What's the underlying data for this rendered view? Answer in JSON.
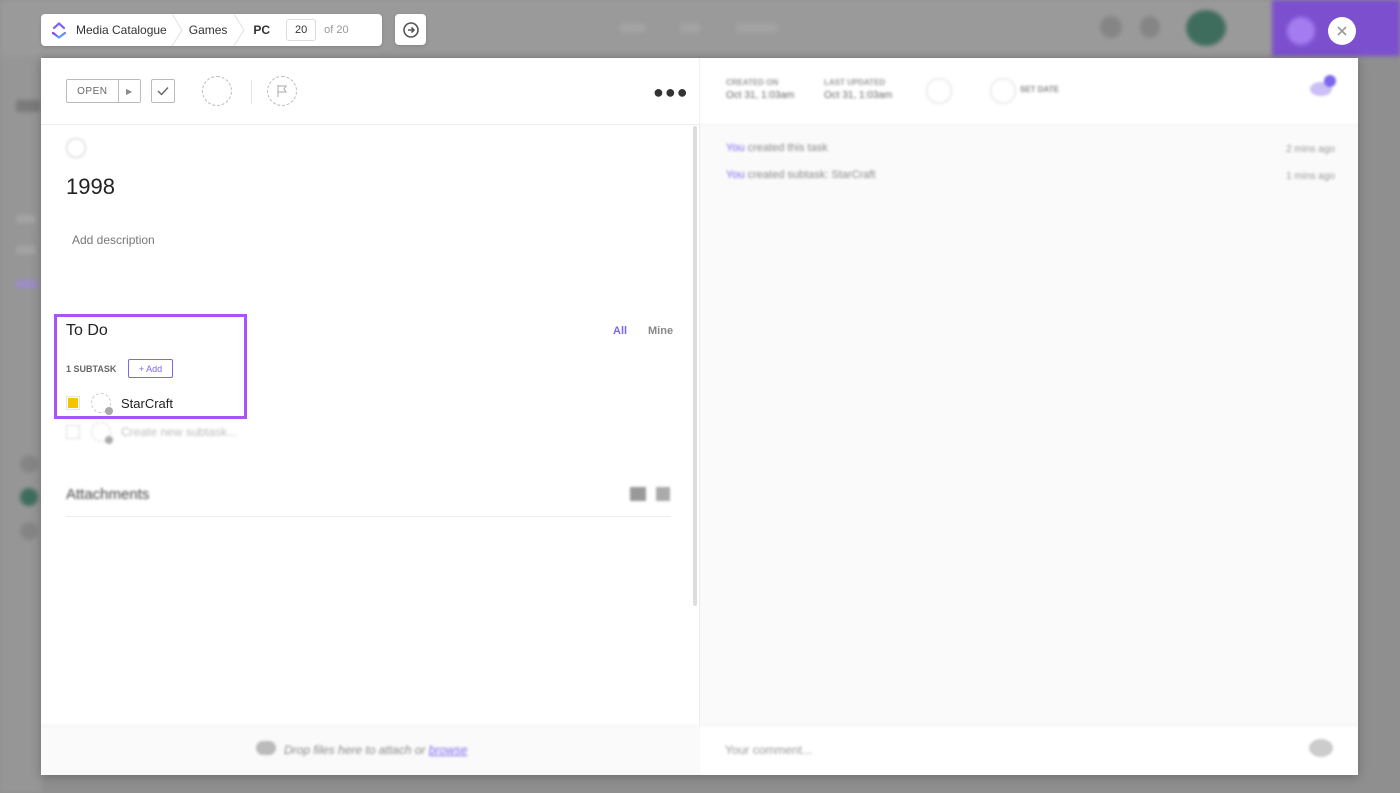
{
  "breadcrumb": {
    "workspace": "Media Catalogue",
    "folder": "Games",
    "list": "PC",
    "current_page": "20",
    "total_pages": "of 20"
  },
  "toolbar": {
    "status": "OPEN"
  },
  "task": {
    "title": "1998",
    "description_placeholder": "Add description"
  },
  "checklist": {
    "title": "To Do",
    "filter_all": "All",
    "filter_mine": "Mine",
    "subtask_count": "1 SUBTASK",
    "add_label": "+ Add",
    "subtasks": [
      {
        "name": "StarCraft",
        "status_color": "#f5c400"
      }
    ],
    "new_subtask_placeholder": "Create new subtask..."
  },
  "attachments": {
    "title": "Attachments",
    "drop_text": "Drop files here to attach or",
    "browse_label": "browse"
  },
  "details": {
    "created_label": "CREATED ON",
    "created_value": "Oct 31, 1:03am",
    "updated_label": "LAST UPDATED",
    "updated_value": "Oct 31, 1:03am",
    "set_date_label": "SET DATE"
  },
  "activity": [
    {
      "who": "You",
      "text": "created this task",
      "time": "2 mins ago"
    },
    {
      "who": "You",
      "text": "created subtask: StarCraft",
      "time": "1 mins ago"
    }
  ],
  "comment": {
    "placeholder": "Your comment..."
  },
  "colors": {
    "accent": "#7b68ee",
    "highlight": "#a855f7",
    "status_yellow": "#f5c400"
  }
}
